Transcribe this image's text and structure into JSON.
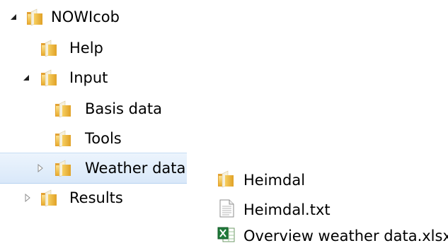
{
  "tree": {
    "items": [
      {
        "label": "NOWIcob",
        "expanded": true
      },
      {
        "label": "Help"
      },
      {
        "label": "Input",
        "expanded": true
      },
      {
        "label": "Basis data"
      },
      {
        "label": "Tools"
      },
      {
        "label": "Weather data",
        "selected": true,
        "expanded": false
      },
      {
        "label": "Results",
        "expanded": false
      }
    ]
  },
  "files": {
    "items": [
      {
        "label": "Heimdal",
        "type": "folder"
      },
      {
        "label": "Heimdal.txt",
        "type": "text-file"
      },
      {
        "label": "Overview weather data.xlsx",
        "type": "excel-file"
      }
    ]
  },
  "colors": {
    "selection": "#d9e8f9",
    "folder": "#f2c14e"
  },
  "icons": {
    "folder": "folder-icon",
    "text-file": "text-file-icon",
    "excel-file": "excel-file-icon",
    "expanded": "expanded-arrow-icon",
    "collapsed": "collapsed-arrow-icon"
  }
}
